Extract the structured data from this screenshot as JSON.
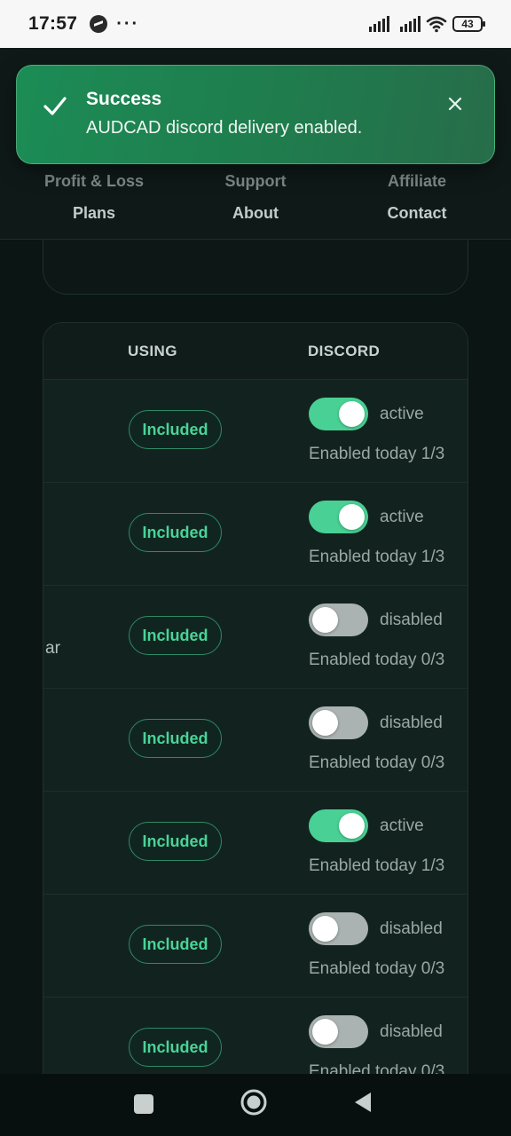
{
  "status_bar": {
    "time": "17:57",
    "dots": "···",
    "battery": "43"
  },
  "toast": {
    "title": "Success",
    "message": "AUDCAD discord delivery enabled.",
    "icon": "check-icon",
    "close_icon": "close-icon",
    "accent": "#1c8c55"
  },
  "nav": {
    "row1": [
      "Profit & Loss",
      "Support",
      "Affiliate"
    ],
    "row2": [
      "Plans",
      "About",
      "Contact"
    ]
  },
  "table": {
    "headers": {
      "using": "USING",
      "discord": "DISCORD"
    },
    "rows": [
      {
        "left": "",
        "using": "Included",
        "on": true,
        "state": "active",
        "enabled": "Enabled today 1/3"
      },
      {
        "left": "",
        "using": "Included",
        "on": true,
        "state": "active",
        "enabled": "Enabled today 1/3"
      },
      {
        "left": "ar",
        "using": "Included",
        "on": false,
        "state": "disabled",
        "enabled": "Enabled today 0/3"
      },
      {
        "left": "",
        "using": "Included",
        "on": false,
        "state": "disabled",
        "enabled": "Enabled today 0/3"
      },
      {
        "left": "",
        "using": "Included",
        "on": true,
        "state": "active",
        "enabled": "Enabled today 1/3"
      },
      {
        "left": "",
        "using": "Included",
        "on": false,
        "state": "disabled",
        "enabled": "Enabled today 0/3"
      },
      {
        "left": "",
        "using": "Included",
        "on": false,
        "state": "disabled",
        "enabled": "Enabled today 0/3"
      }
    ]
  },
  "colors": {
    "toggle_on": "#49d094",
    "toggle_off": "#aab3b1",
    "badge_text": "#4ad398"
  }
}
